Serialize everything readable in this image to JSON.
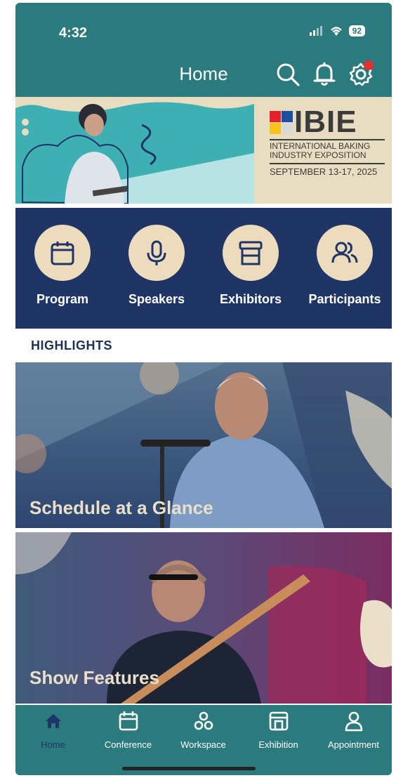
{
  "status": {
    "time": "4:32",
    "battery": "92"
  },
  "header": {
    "title": "Home"
  },
  "banner": {
    "logo_word": "IBIE",
    "logo_line1": "INTERNATIONAL BAKING",
    "logo_line2": "INDUSTRY EXPOSITION",
    "logo_date": "SEPTEMBER 13-17, 2025",
    "logo_colors": [
      "#e3222b",
      "#1d4fa3",
      "#f6c21b",
      "#d9d9d9"
    ]
  },
  "quicknav": [
    {
      "label": "Program",
      "icon": "calendar-icon"
    },
    {
      "label": "Speakers",
      "icon": "microphone-icon"
    },
    {
      "label": "Exhibitors",
      "icon": "booth-icon"
    },
    {
      "label": "Participants",
      "icon": "people-icon"
    }
  ],
  "highlights": {
    "heading": "HIGHLIGHTS",
    "cards": [
      {
        "title": "Schedule at a Glance"
      },
      {
        "title": "Show Features"
      }
    ]
  },
  "tabbar": [
    {
      "label": "Home",
      "icon": "home-icon",
      "active": true
    },
    {
      "label": "Conference",
      "icon": "calendar-icon"
    },
    {
      "label": "Workspace",
      "icon": "workspace-icon"
    },
    {
      "label": "Exhibition",
      "icon": "exhibition-icon"
    },
    {
      "label": "Appointment",
      "icon": "person-icon"
    }
  ],
  "colors": {
    "teal": "#2a7a7e",
    "navy": "#1f3566",
    "cream": "#ecdcbd"
  }
}
